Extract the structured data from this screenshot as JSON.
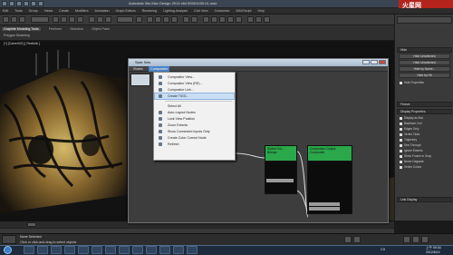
{
  "title_bar": {
    "text": "Autodesk 3ds Max Design 2013 x64     50001030-01.max",
    "brand": "火星网",
    "brand_sub": "hxsd.com"
  },
  "menu": [
    "Edit",
    "Tools",
    "Group",
    "Views",
    "Create",
    "Modifiers",
    "Animation",
    "Graph Editors",
    "Rendering",
    "Lighting Analysis",
    "Civil View",
    "Customize",
    "MAXScript",
    "Help"
  ],
  "ribbon": {
    "tabs": [
      "Graphite Modeling Tools",
      "Freeform",
      "Selection",
      "Object Paint"
    ],
    "sub": "Polygon Modeling"
  },
  "viewport": {
    "label": "[+] [Camer001] [ Realistic ]"
  },
  "right_panel": {
    "buttons": [
      "Hide",
      "Hide Unselected",
      "Hide Unselected",
      "Hide by Name...",
      "Hide by Hit"
    ],
    "hide_props": "Hide Properties",
    "freeze": "Freeze",
    "display_props": "Display Properties",
    "checks": [
      "Display as Box",
      "Backface Cull",
      "Edges Only",
      "Vertex Ticks",
      "Trajectory",
      "See-Through",
      "Ignore Extents",
      "Show Frozen in Gray",
      "Never Degrade",
      "Vertex Colors"
    ],
    "link_display": "Link Display"
  },
  "slate": {
    "title": "Slate Sets",
    "menu": [
      "States",
      "Compositor"
    ],
    "context_menu": [
      {
        "label": "Compositor View...",
        "icon": "view-icon"
      },
      {
        "label": "Compositor View (RE)...",
        "icon": "view-re-icon"
      },
      {
        "label": "Compositor Link...",
        "icon": "link-icon"
      },
      {
        "label": "Create TIGG...",
        "icon": "tigg-icon",
        "highlight": true
      },
      {
        "label": "Select All",
        "icon": ""
      },
      {
        "label": "Auto-Layout Nodes",
        "icon": "layout-icon"
      },
      {
        "label": "Lock View Position",
        "icon": "lock-icon"
      },
      {
        "label": "Zoom Extents",
        "icon": "zoom-icon"
      },
      {
        "label": "Show Connected Inputs Only",
        "icon": "inputs-icon"
      },
      {
        "label": "Create Color Correct Node",
        "icon": "color-icon"
      },
      {
        "label": "Refresh",
        "icon": "refresh-icon"
      }
    ],
    "nodes": [
      {
        "title": "Slate4"
      },
      {
        "title": "Slate# Out...",
        "sub": "Bitmap"
      },
      {
        "title": "Compositor Output",
        "sub": "Composite"
      }
    ]
  },
  "status": {
    "selected": "None Selected",
    "prompt": "Click or click-and-drag to select objects"
  },
  "taskbar": {
    "time": "上午 09:34",
    "date": "2012/6/14",
    "lang": "CH"
  },
  "colors": {
    "node_header": "#2aa84a",
    "menu_highlight": "#c9def5",
    "active_menu": "#4a82c4"
  }
}
